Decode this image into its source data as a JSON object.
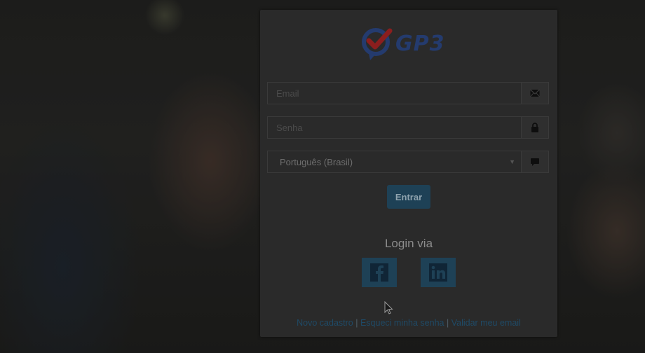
{
  "brand": {
    "logo_text": "GP3",
    "logo_color": "#243b6e",
    "check_color": "#8b1e1e"
  },
  "form": {
    "email": {
      "placeholder": "Email",
      "icon": "envelope-icon"
    },
    "password": {
      "placeholder": "Senha",
      "icon": "lock-icon"
    },
    "language": {
      "selected": "Português (Brasil)",
      "icon": "comment-icon"
    },
    "submit_label": "Entrar"
  },
  "social": {
    "heading": "Login via",
    "providers": [
      {
        "name": "facebook",
        "icon": "facebook-icon"
      },
      {
        "name": "linkedin",
        "icon": "linkedin-icon"
      }
    ]
  },
  "links": {
    "register": "Novo cadastro",
    "forgot": "Esqueci minha senha",
    "validate": "Validar meu email",
    "separator": "|"
  },
  "colors": {
    "button": "#1e4156",
    "panel": "#2a2a2a"
  }
}
